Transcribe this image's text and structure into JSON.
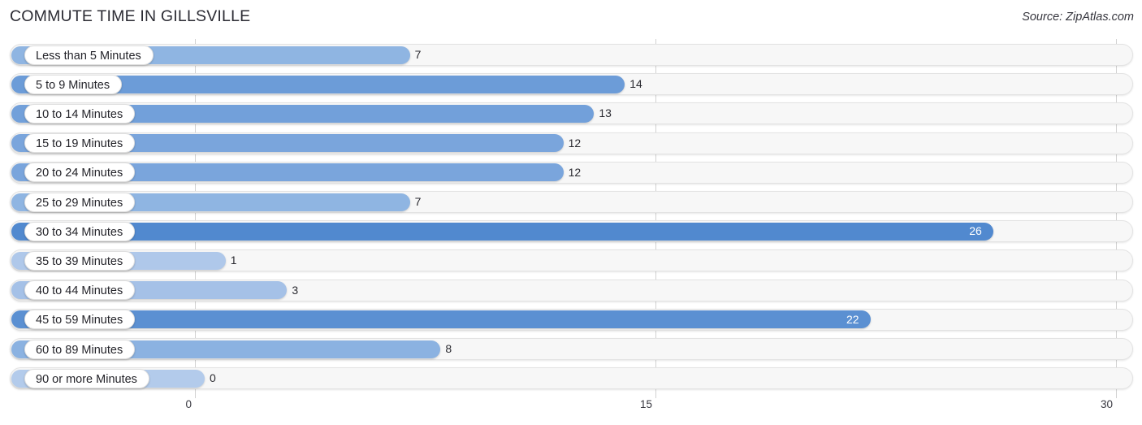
{
  "header": {
    "title": "COMMUTE TIME IN GILLSVILLE",
    "source": "Source: ZipAtlas.com"
  },
  "chart_data": {
    "type": "bar",
    "orientation": "horizontal",
    "title": "COMMUTE TIME IN GILLSVILLE",
    "xlabel": "",
    "ylabel": "",
    "xlim": [
      0,
      30
    ],
    "ticks": [
      "0",
      "15",
      "30"
    ],
    "tick_values": [
      0,
      15,
      30
    ],
    "grid": true,
    "legend": "none",
    "categories": [
      "Less than 5 Minutes",
      "5 to 9 Minutes",
      "10 to 14 Minutes",
      "15 to 19 Minutes",
      "20 to 24 Minutes",
      "25 to 29 Minutes",
      "30 to 34 Minutes",
      "35 to 39 Minutes",
      "40 to 44 Minutes",
      "45 to 59 Minutes",
      "60 to 89 Minutes",
      "90 or more Minutes"
    ],
    "values": [
      7,
      14,
      13,
      12,
      12,
      7,
      26,
      1,
      3,
      22,
      8,
      0
    ],
    "value_labels": [
      "7",
      "14",
      "13",
      "12",
      "12",
      "7",
      "26",
      "1",
      "3",
      "22",
      "8",
      "0"
    ],
    "bar_colors": [
      "#8FB5E2",
      "#6C9CD8",
      "#72A0DA",
      "#7AA5DC",
      "#7AA5DC",
      "#8FB5E2",
      "#5189CF",
      "#AFC8EA",
      "#A5C1E7",
      "#5B90D2",
      "#8BB2E1",
      "#B3CBEB"
    ],
    "label_inside": [
      false,
      false,
      false,
      false,
      false,
      false,
      true,
      false,
      false,
      true,
      false,
      false
    ]
  },
  "colors": {
    "accent": "#6C9CD8",
    "track": "#f7f7f7",
    "grid": "#d2d2d2",
    "text": "#2b2b33"
  }
}
